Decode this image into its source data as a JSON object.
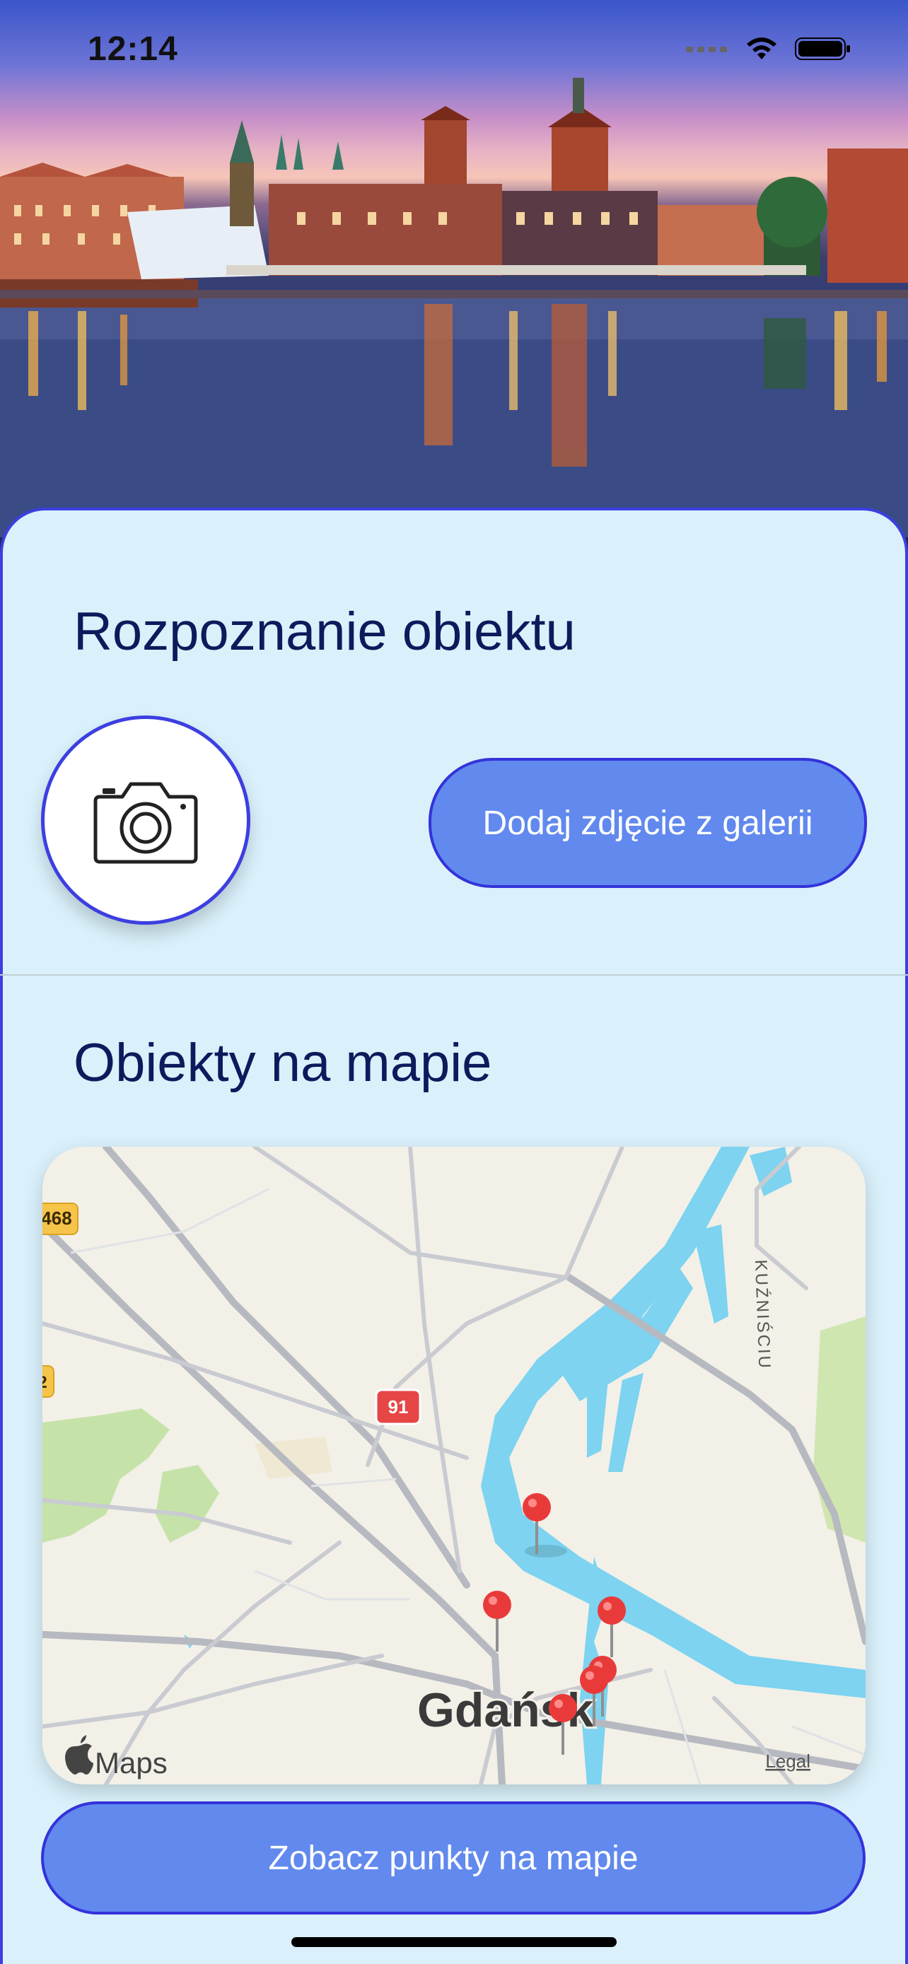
{
  "status_bar": {
    "time": "12:14"
  },
  "recognition": {
    "title": "Rozpoznanie obiektu",
    "camera_icon": "camera-icon",
    "gallery_button": "Dodaj zdjęcie z galerii"
  },
  "map_section": {
    "title": "Obiekty na mapie",
    "city_label": "Gdańsk",
    "road_badges": [
      "468",
      "91",
      "2"
    ],
    "street_label": "KUŹNIŚCIU",
    "attribution": "Maps",
    "legal": "Legal",
    "pin_icon": "map-pin-icon"
  },
  "bottom_button": "Zobacz punkty na mapie",
  "colors": {
    "accent": "#3c3fe0",
    "button": "#6189ee",
    "sheet": "#daf1fb",
    "title": "#0d1a5c"
  }
}
